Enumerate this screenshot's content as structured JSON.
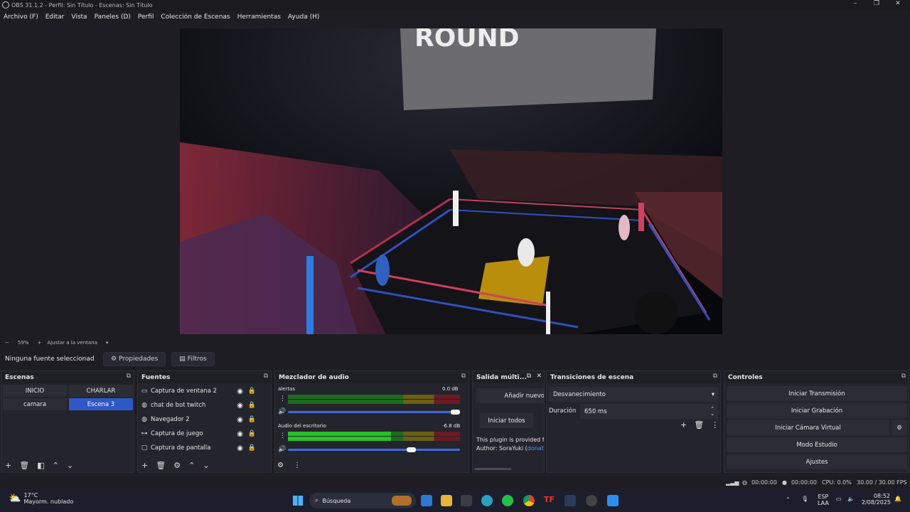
{
  "window": {
    "title": "OBS 31.1.2 - Perfil: Sin Título - Escenas: Sin Título",
    "min": "–",
    "max": "❐",
    "close": "✕"
  },
  "menu": [
    "Archivo (F)",
    "Editar",
    "Vista",
    "Paneles (D)",
    "Perfil",
    "Colección de Escenas",
    "Herramientas",
    "Ayuda (H)"
  ],
  "zoom": {
    "minus": "−",
    "percent": "59%",
    "plus": "+",
    "fit": "Ajustar a la ventana",
    "dropdown": "▾"
  },
  "source_toolbar": {
    "no_source": "Ninguna fuente seleccionad",
    "properties": "Propiedades",
    "filters": "Filtros"
  },
  "scenes": {
    "title": "Escenas",
    "items": [
      {
        "label": "INICIO",
        "active": false
      },
      {
        "label": "CHARLAR",
        "active": false
      },
      {
        "label": "camara",
        "active": false
      },
      {
        "label": "Escena 3",
        "active": true
      }
    ]
  },
  "sources": {
    "title": "Fuentes",
    "items": [
      {
        "label": "Captura de ventana 2",
        "icon": "window-icon"
      },
      {
        "label": "chat de bot twitch",
        "icon": "globe-icon"
      },
      {
        "label": "Navegador 2",
        "icon": "globe-icon"
      },
      {
        "label": "Captura de juego",
        "icon": "gamepad-icon"
      },
      {
        "label": "Captura de pantalla",
        "icon": "monitor-icon"
      }
    ]
  },
  "mixer": {
    "title": "Mezclador de audio",
    "tracks": [
      {
        "name": "alertas",
        "db": "0.0 dB",
        "level": 0.0
      },
      {
        "name": "Audio del escritorio",
        "db": "-6.8 dB",
        "level": 0.6
      }
    ],
    "scale": [
      "-60",
      "-55",
      "-50",
      "-45",
      "-40",
      "-35",
      "-30",
      "-25",
      "-20",
      "-15",
      "-10",
      "-5",
      "0"
    ]
  },
  "multistream": {
    "title": "Salida múlti...",
    "add_new": "Añadir nuevo",
    "start_all": "Iniciar todos",
    "plugin_text": "This plugin is provided fr",
    "author_prefix": "Author: SoraYuki (",
    "author_link": "donat"
  },
  "transitions": {
    "title": "Transiciones de escena",
    "selected": "Desvanecimiento",
    "duration_label": "Duración",
    "duration_value": "650 ms"
  },
  "controls": {
    "title": "Controles",
    "start_stream": "Iniciar Transmisión",
    "start_record": "Iniciar Grabación",
    "start_vcam": "Iniciar Cámara Virtual",
    "studio_mode": "Modo Estudio",
    "settings": "Ajustes"
  },
  "status": {
    "rec_time": "00:00:00",
    "stream_time": "00:00:00",
    "cpu": "CPU: 0.0%",
    "fps": "30.00 / 30.00 FPS"
  },
  "taskbar": {
    "temp": "17°C",
    "weather": "Mayorm. nublado",
    "search": "Búsqueda",
    "lang": "ESP",
    "lang2": "LAA",
    "time": "08:52",
    "date": "2/08/2025",
    "badge_weather": "2"
  },
  "colors": {
    "accent": "#2f58c7",
    "bg": "#1d1d23",
    "dock": "#24242c"
  }
}
